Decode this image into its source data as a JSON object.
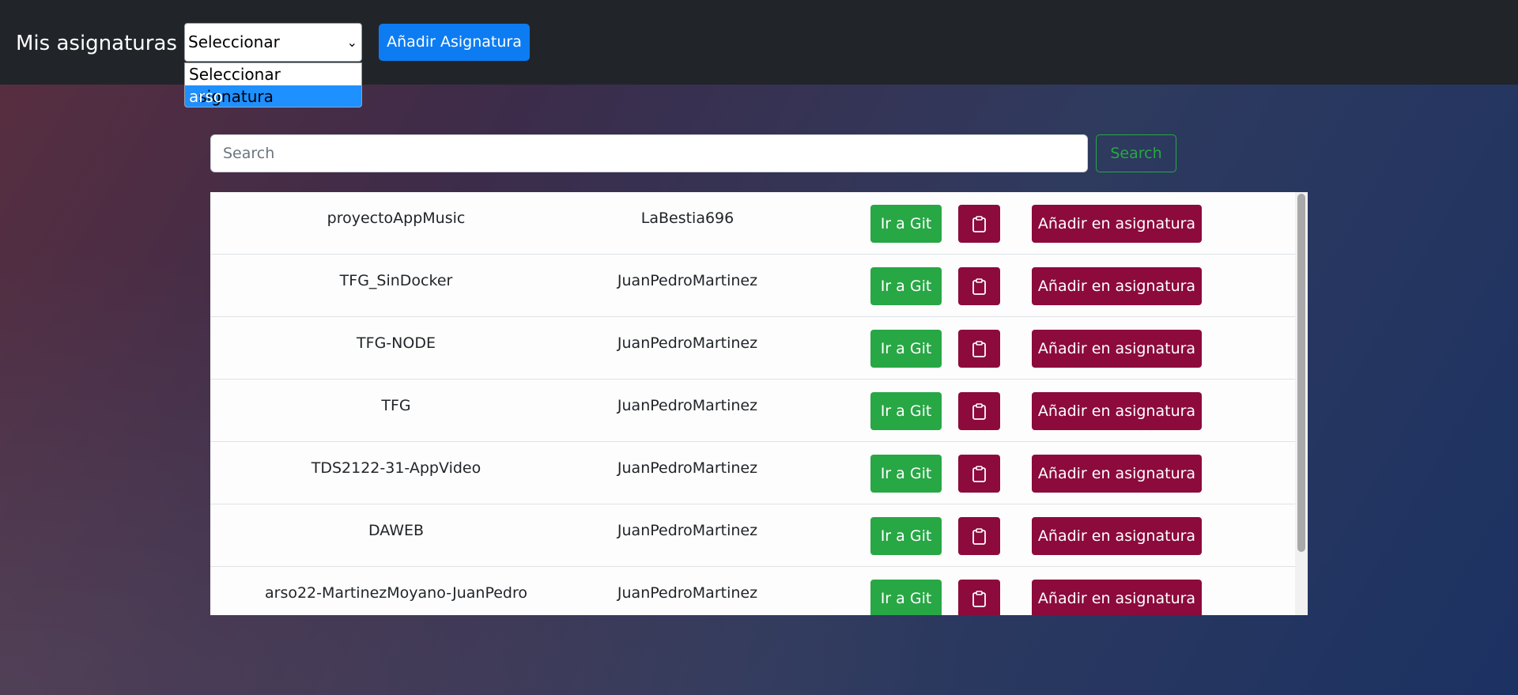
{
  "navbar": {
    "brand": "Mis asignaturas",
    "select": {
      "selected": "Seleccionar asignatura",
      "options": [
        "Seleccionar asignatura",
        "arso"
      ],
      "highlighted": "arso"
    },
    "add_subject_label": "Añadir Asignatura"
  },
  "search": {
    "placeholder": "Search",
    "button_label": "Search"
  },
  "table": {
    "git_label": "Ir a Git",
    "add_label": "Añadir en asignatura",
    "clipboard_icon": "clipboard-icon",
    "rows": [
      {
        "name": "proyectoAppMusic",
        "owner": "LaBestia696"
      },
      {
        "name": "TFG_SinDocker",
        "owner": "JuanPedroMartinez"
      },
      {
        "name": "TFG-NODE",
        "owner": "JuanPedroMartinez"
      },
      {
        "name": "TFG",
        "owner": "JuanPedroMartinez"
      },
      {
        "name": "TDS2122-31-AppVideo",
        "owner": "JuanPedroMartinez"
      },
      {
        "name": "DAWEB",
        "owner": "JuanPedroMartinez"
      },
      {
        "name": "arso22-MartinezMoyano-JuanPedro",
        "owner": "JuanPedroMartinez"
      }
    ]
  },
  "colors": {
    "navbar": "#212529",
    "primary": "#0d7cf2",
    "success": "#28a745",
    "accent": "#8c0a3c"
  }
}
